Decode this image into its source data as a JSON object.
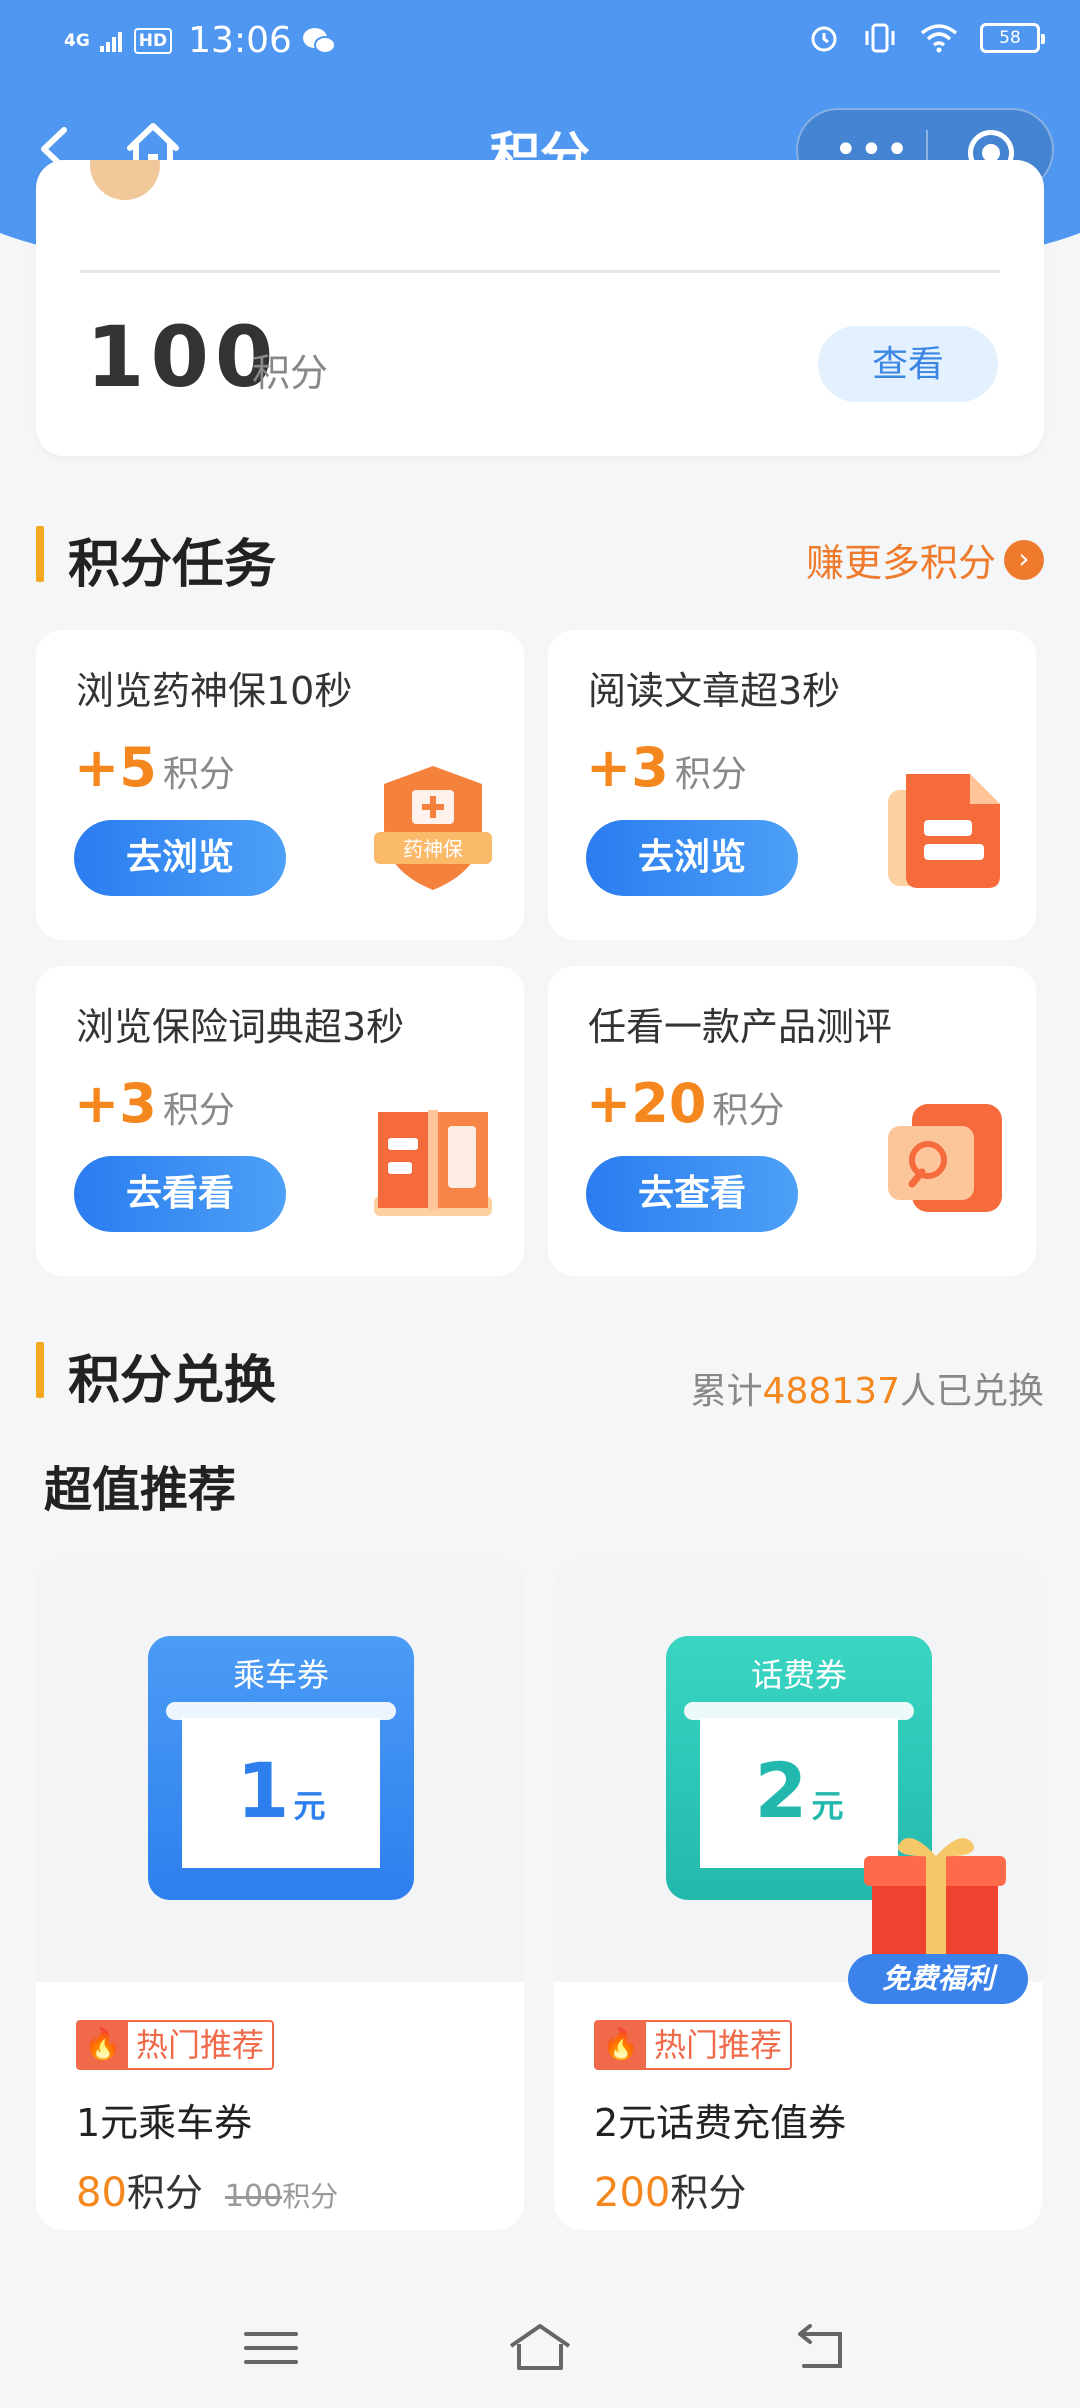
{
  "status_bar": {
    "network": "4G",
    "hd": "HD",
    "time": "13:06",
    "battery": "58"
  },
  "nav": {
    "title": "积分",
    "more_icon": "more-dots-icon",
    "close_icon": "target-circle-icon"
  },
  "points_card": {
    "value": "100",
    "unit": "积分",
    "view_label": "查看"
  },
  "tasks_section": {
    "title": "积分任务",
    "earn_more": "赚更多积分",
    "tasks": [
      {
        "title": "浏览药神保10秒",
        "plus": "+5",
        "unit": "积分",
        "button": "去浏览",
        "icon": "shield-medkit-icon",
        "icon_text": "药神保"
      },
      {
        "title": "阅读文章超3秒",
        "plus": "+3",
        "unit": "积分",
        "button": "去浏览",
        "icon": "document-icon"
      },
      {
        "title": "浏览保险词典超3秒",
        "plus": "+3",
        "unit": "积分",
        "button": "去看看",
        "icon": "open-book-icon"
      },
      {
        "title": "任看一款产品测评",
        "plus": "+20",
        "unit": "积分",
        "button": "去查看",
        "icon": "search-doc-icon"
      }
    ]
  },
  "exchange_section": {
    "title": "积分兑换",
    "count_prefix": "累计",
    "count": "488137",
    "count_suffix": "人已兑换",
    "recommend_title": "超值推荐",
    "products": [
      {
        "voucher_label": "乘车券",
        "voucher_amount": "1",
        "voucher_unit": "元",
        "tag": "热门推荐",
        "name": "1元乘车券",
        "price": "80",
        "price_unit": "积分",
        "old_price": "100",
        "old_unit": "积分"
      },
      {
        "voucher_label": "话费券",
        "voucher_amount": "2",
        "voucher_unit": "元",
        "tag": "热门推荐",
        "name": "2元话费充值券",
        "price": "200",
        "price_unit": "积分"
      }
    ],
    "free_badge": "免费福利"
  },
  "colors": {
    "brand_blue": "#4f97f0",
    "accent_orange": "#f5871f",
    "ride_voucher": "#3d8ef2",
    "phone_voucher": "#2fc7b8"
  }
}
